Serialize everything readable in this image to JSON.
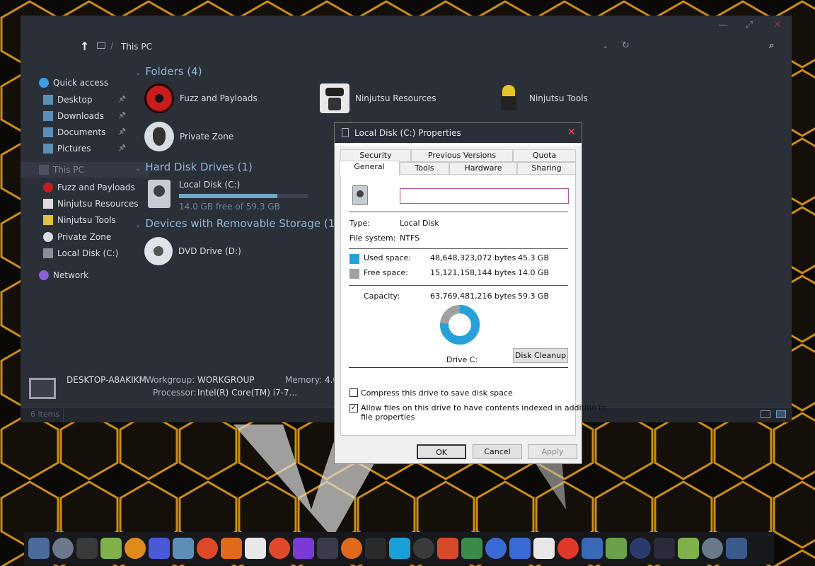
{
  "explorer": {
    "breadcrumb": "This PC",
    "sidebar": [
      {
        "label": "Quick access",
        "icon": "star-icon"
      },
      {
        "label": "Desktop",
        "icon": "desktop-folder-icon",
        "pinned": true
      },
      {
        "label": "Downloads",
        "icon": "downloads-icon",
        "pinned": true
      },
      {
        "label": "Documents",
        "icon": "documents-icon",
        "pinned": true
      },
      {
        "label": "Pictures",
        "icon": "pictures-icon",
        "pinned": true
      },
      {
        "label": "This PC",
        "icon": "computer-icon",
        "selected": true
      },
      {
        "label": "Fuzz and Payloads",
        "icon": "sharingan-icon"
      },
      {
        "label": "Ninjutsu Resources",
        "icon": "hacker-icon"
      },
      {
        "label": "Ninjutsu Tools",
        "icon": "ninja-icon"
      },
      {
        "label": "Private Zone",
        "icon": "mask-icon"
      },
      {
        "label": "Local Disk (C:)",
        "icon": "drive-icon"
      },
      {
        "label": "Network",
        "icon": "network-icon"
      }
    ],
    "groups": {
      "folders": "Folders (4)",
      "drives": "Hard Disk Drives (1)",
      "removable": "Devices with Removable Storage (1)"
    },
    "folders": [
      "Fuzz and Payloads",
      "Ninjutsu Resources",
      "Ninjutsu Tools",
      "Private Zone"
    ],
    "drive": {
      "name": "Local Disk (C:)",
      "free": "14.0 GB free of 59.3 GB",
      "used_fraction": 0.763
    },
    "dvd": "DVD Drive (D:)",
    "details": {
      "computer": "DESKTOP-A8AKIKM",
      "workgroup_label": "Workgroup:",
      "workgroup": "WORKGROUP",
      "memory_label": "Memory:",
      "memory": "4.0",
      "processor_label": "Processor:",
      "processor": "Intel(R) Core(TM) i7-7..."
    },
    "status": "6 items"
  },
  "dialog": {
    "title": "Local Disk (C:) Properties",
    "tabs_back": [
      "Security",
      "Previous Versions",
      "Quota"
    ],
    "tabs_front": [
      "General",
      "Tools",
      "Hardware",
      "Sharing"
    ],
    "name_value": "",
    "type_label": "Type:",
    "type_value": "Local Disk",
    "fs_label": "File system:",
    "fs_value": "NTFS",
    "used_label": "Used space:",
    "used_bytes": "48,648,323,072 bytes",
    "used_gb": "45.3 GB",
    "free_label": "Free space:",
    "free_bytes": "15,121,158,144 bytes",
    "free_gb": "14.0 GB",
    "cap_label": "Capacity:",
    "cap_bytes": "63,769,481,216 bytes",
    "cap_gb": "59.3 GB",
    "drive_label": "Drive C:",
    "cleanup": "Disk Cleanup",
    "compress": "Compress this drive to save disk space",
    "index_line1": "Allow files on this drive to have contents indexed in addition to",
    "index_line2": "file properties",
    "ok": "OK",
    "cancel": "Cancel",
    "apply": "Apply",
    "used_color": "#26a0da",
    "free_color": "#a0a0a0"
  },
  "taskbar": {
    "icons": [
      "explorer-icon",
      "photos-icon",
      "hacker-icon",
      "settings-icon",
      "search-icon",
      "apps-icon",
      "folder-icon",
      "brave-icon",
      "firefox-icon",
      "chrome-icon",
      "toolbox-icon",
      "tor-icon",
      "vpn-icon",
      "openvpn-icon",
      "terminal-icon",
      "edge-icon",
      "s2g-icon",
      "ccleaner-icon",
      "monitor-icon",
      "network-icon",
      "remote-icon",
      "globe-icon",
      "opera-icon",
      "qbittorrent-icon",
      "notepad-icon",
      "powershell-icon",
      "cmd-icon",
      "settings-icon",
      "calculator-icon",
      "control-icon"
    ]
  }
}
